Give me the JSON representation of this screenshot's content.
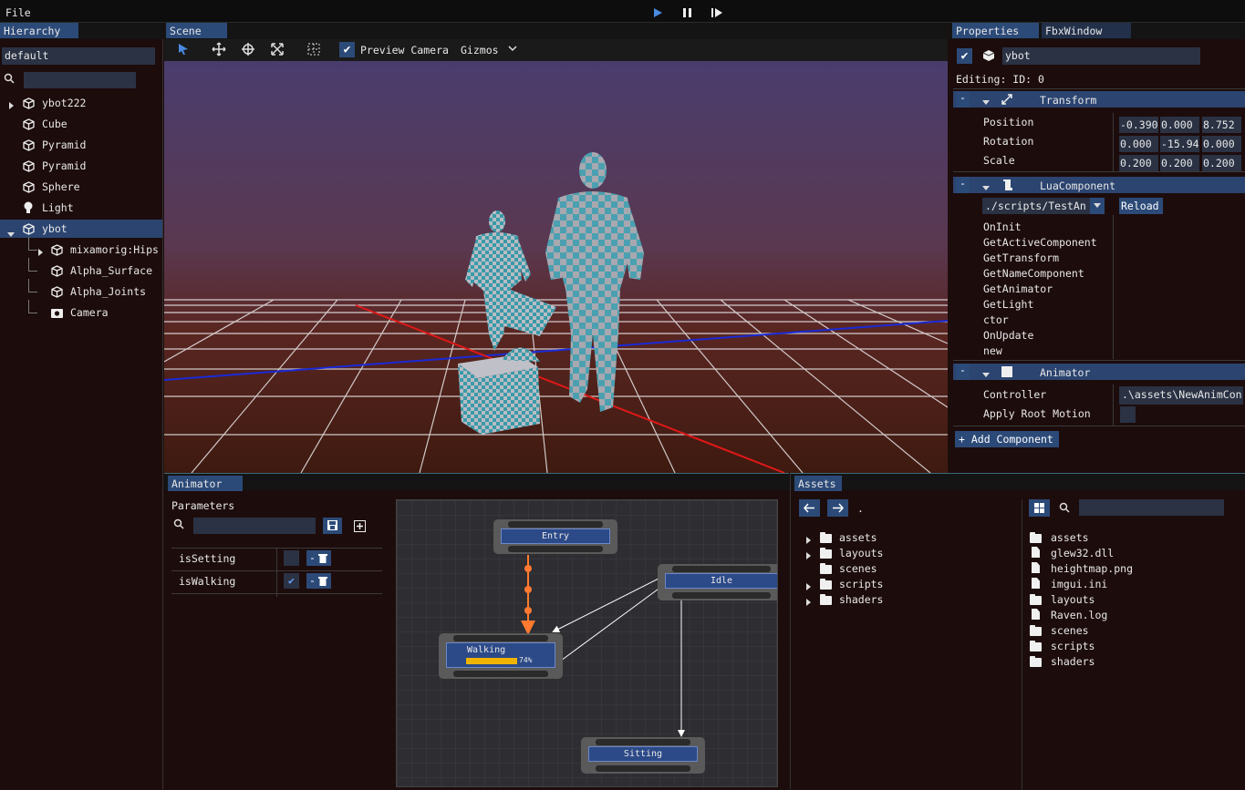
{
  "menu": {
    "file": "File"
  },
  "playback": {
    "play": "play-icon",
    "pause": "pause-icon",
    "step": "step-icon"
  },
  "hierarchy": {
    "tab": "Hierarchy",
    "scene_name": "default",
    "items": [
      {
        "label": "ybot222",
        "icon": "cube-icon"
      },
      {
        "label": "Cube",
        "icon": "cube-icon"
      },
      {
        "label": "Pyramid",
        "icon": "cube-icon"
      },
      {
        "label": "Pyramid",
        "icon": "cube-icon"
      },
      {
        "label": "Sphere",
        "icon": "cube-icon"
      },
      {
        "label": "Light",
        "icon": "lightbulb-icon"
      },
      {
        "label": "ybot",
        "icon": "cube-icon"
      }
    ],
    "children": [
      {
        "label": "mixamorig:Hips"
      },
      {
        "label": "Alpha_Surface"
      },
      {
        "label": "Alpha_Joints"
      },
      {
        "label": "Camera"
      }
    ]
  },
  "scene": {
    "tab": "Scene",
    "preview_camera": "Preview Camera",
    "gizmos": "Gizmos"
  },
  "properties": {
    "tab": "Properties",
    "tab2": "FbxWindow",
    "object_name": "ybot",
    "editing": "Editing: ID: 0",
    "transform": {
      "title": "Transform",
      "rows": [
        {
          "label": "Position",
          "values": [
            "-0.390",
            "0.000",
            "8.752"
          ]
        },
        {
          "label": "Rotation",
          "values": [
            "0.000",
            "-15.94",
            "0.000"
          ]
        },
        {
          "label": "Scale",
          "values": [
            "0.200",
            "0.200",
            "0.200"
          ]
        }
      ]
    },
    "lua": {
      "title": "LuaComponent",
      "script": "./scripts/TestAn",
      "reload": "Reload",
      "functions": [
        "OnInit",
        "GetActiveComponent",
        "GetTransform",
        "GetNameComponent",
        "GetAnimator",
        "GetLight",
        "ctor",
        "OnUpdate",
        "new"
      ]
    },
    "animator": {
      "title": "Animator",
      "controller_label": "Controller",
      "controller_value": ".\\assets\\NewAnimCon",
      "root_motion_label": "Apply Root Motion"
    },
    "add_component": "+ Add Component",
    "collapse": "-"
  },
  "animator_panel": {
    "tab": "Animator",
    "parameters_label": "Parameters",
    "params": [
      {
        "name": "isSetting",
        "checked": false
      },
      {
        "name": "isWalking",
        "checked": true
      }
    ],
    "delete_label": "-",
    "nodes": {
      "entry": "Entry",
      "idle": "Idle",
      "walking": "Walking",
      "sitting": "Sitting",
      "progress_label": "74%",
      "progress": 0.74
    }
  },
  "assets": {
    "tab": "Assets",
    "path": ".",
    "tree": [
      "assets",
      "layouts",
      "scenes",
      "scripts",
      "shaders"
    ],
    "files": [
      {
        "name": "assets",
        "type": "folder"
      },
      {
        "name": "glew32.dll",
        "type": "file"
      },
      {
        "name": "heightmap.png",
        "type": "image"
      },
      {
        "name": "imgui.ini",
        "type": "file"
      },
      {
        "name": "layouts",
        "type": "folder"
      },
      {
        "name": "Raven.log",
        "type": "file"
      },
      {
        "name": "scenes",
        "type": "folder"
      },
      {
        "name": "scripts",
        "type": "folder"
      },
      {
        "name": "shaders",
        "type": "folder"
      }
    ]
  },
  "colors": {
    "accent": "#2c4a78",
    "transition": "#ff7a30",
    "progress": "#f0b400"
  }
}
